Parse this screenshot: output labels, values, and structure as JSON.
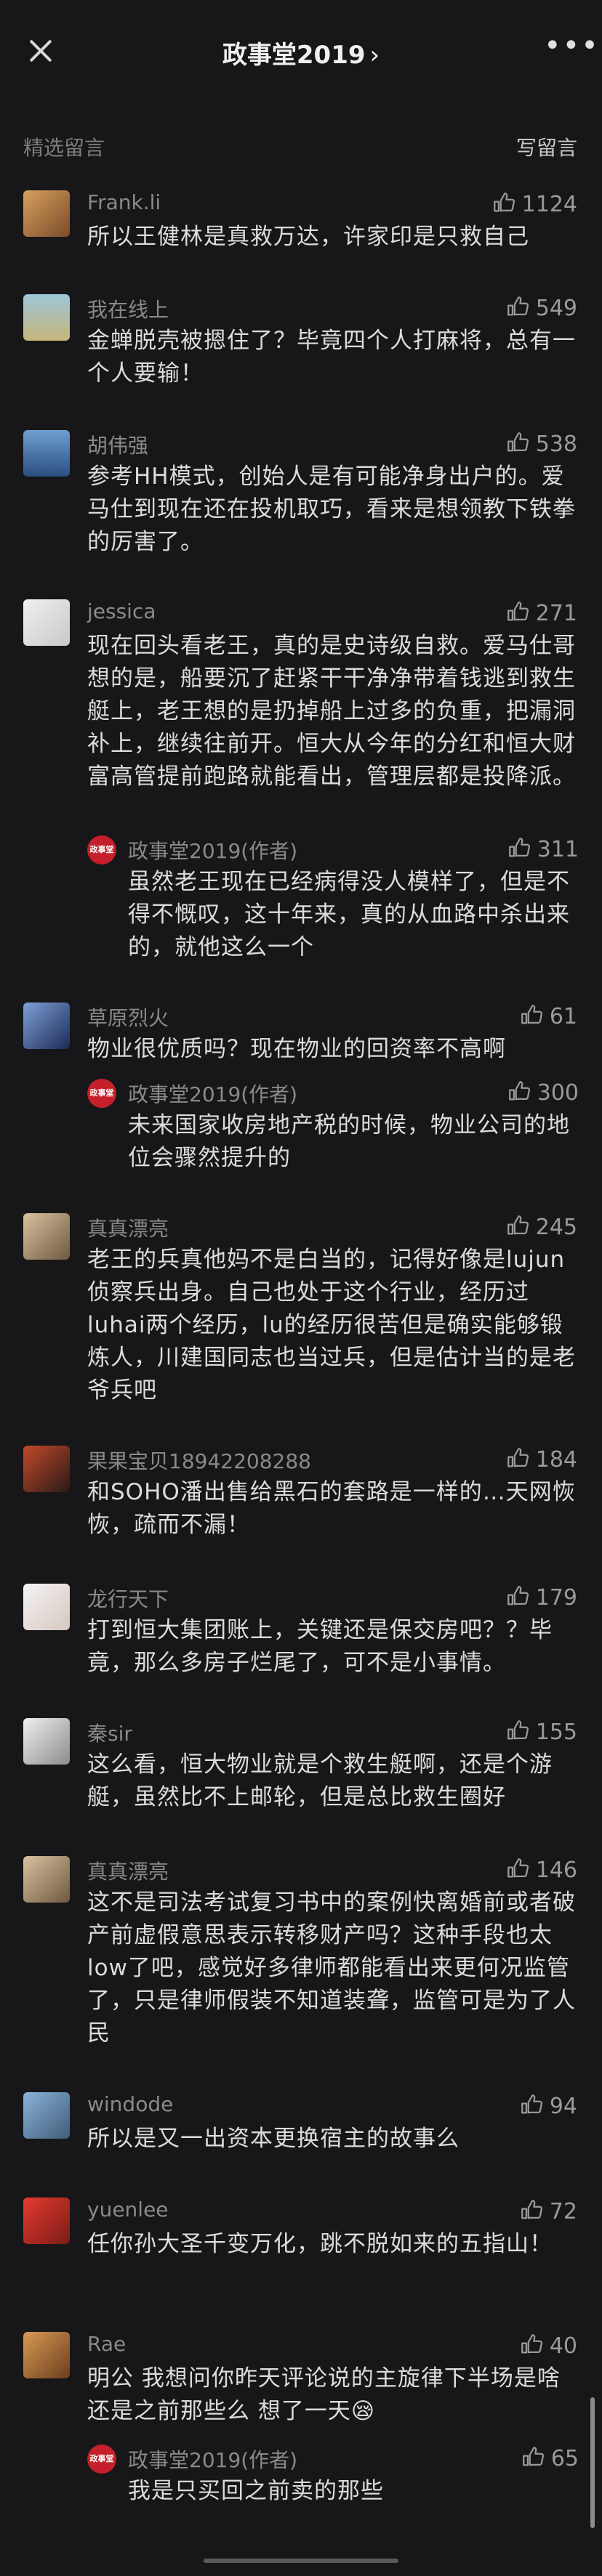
{
  "header": {
    "title": "政事堂2019",
    "title_chevron": "›",
    "more": "•••"
  },
  "section": {
    "label": "精选留言",
    "write_label": "写留言"
  },
  "colors": {
    "background": "#171618",
    "avatar_red": "#c41f2a"
  },
  "comments": [
    {
      "name": "Frank.li",
      "likes": "1124",
      "text": "所以王健林是真救万达，许家印是只救自己"
    },
    {
      "name": "我在线上",
      "likes": "549",
      "text": "金蝉脱壳被摁住了？毕竟四个人打麻将，总有一个人要输！"
    },
    {
      "name": "胡伟强",
      "likes": "538",
      "text": "参考HH模式，创始人是有可能净身出户的。爱马仕到现在还在投机取巧，看来是想领教下铁拳的厉害了。"
    },
    {
      "name": "jessica",
      "likes": "271",
      "text": "现在回头看老王，真的是史诗级自救。爱马仕哥想的是，船要沉了赶紧干干净净带着钱逃到救生艇上，老王想的是扔掉船上过多的负重，把漏洞补上，继续往前开。恒大从今年的分红和恒大财富高管提前跑路就能看出，管理层都是投降派。",
      "reply": {
        "name": "政事堂2019(作者)",
        "likes": "311",
        "text": "虽然老王现在已经病得没人模样了，但是不得不慨叹，这十年来，真的从血路中杀出来的，就他这么一个"
      }
    },
    {
      "name": "草原烈火",
      "likes": "61",
      "text": "物业很优质吗？现在物业的回资率不高啊",
      "reply": {
        "name": "政事堂2019(作者)",
        "likes": "300",
        "text": "未来国家收房地产税的时候，物业公司的地位会骤然提升的"
      }
    },
    {
      "name": "真真漂亮",
      "likes": "245",
      "text": "老王的兵真他妈不是白当的，记得好像是lujun侦察兵出身。自己也处于这个行业，经历过luhai两个经历，lu的经历很苦但是确实能够锻炼人，川建国同志也当过兵，但是估计当的是老爷兵吧"
    },
    {
      "name": "果果宝贝18942208288",
      "likes": "184",
      "text": "和SOHO潘出售给黑石的套路是一样的…天网恢恢，疏而不漏！"
    },
    {
      "name": "龙行天下",
      "likes": "179",
      "text": "打到恒大集团账上，关键还是保交房吧？？毕竟，那么多房子烂尾了，可不是小事情。"
    },
    {
      "name": "秦sir",
      "likes": "155",
      "text": "这么看，恒大物业就是个救生艇啊，还是个游艇，虽然比不上邮轮，但是总比救生圈好"
    },
    {
      "name": "真真漂亮",
      "likes": "146",
      "text": "这不是司法考试复习书中的案例快离婚前或者破产前虚假意思表示转移财产吗？这种手段也太low了吧，感觉好多律师都能看出来更何况监管了，只是律师假装不知道装聋，监管可是为了人民"
    },
    {
      "name": "windode",
      "likes": "94",
      "text": "所以是又一出资本更换宿主的故事么"
    },
    {
      "name": "yuenlee",
      "likes": "72",
      "text": "任你孙大圣千变万化，跳不脱如来的五指山！"
    },
    {
      "name": "Rae",
      "likes": "40",
      "text": "明公 我想问你昨天评论说的主旋律下半场是啥 还是之前那些么 想了一天😪",
      "reply": {
        "name": "政事堂2019(作者)",
        "likes": "65",
        "text": "我是只买回之前卖的那些"
      }
    }
  ]
}
